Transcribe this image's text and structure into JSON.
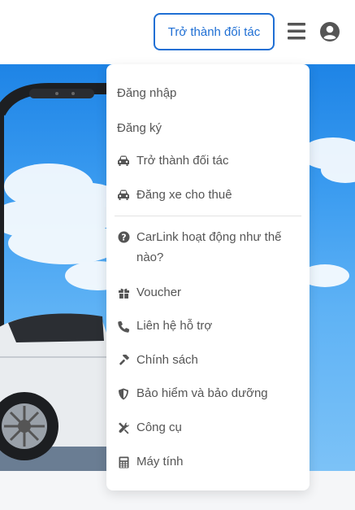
{
  "header": {
    "partner_button_label": "Trở thành đối tác",
    "menu_icon": "hamburger-icon",
    "user_icon": "user-circle-icon"
  },
  "menu": {
    "login": "Đăng nhập",
    "register": "Đăng ký",
    "become_partner": "Trở thành đối tác",
    "list_car": "Đăng xe cho thuê",
    "how_it_works_line1": "CarLink hoạt động như thế",
    "how_it_works_line2": "nào?",
    "voucher": "Voucher",
    "contact_support": "Liên hệ hỗ trợ",
    "policy": "Chính sách",
    "insurance": "Bảo hiểm và bảo dưỡng",
    "tools": "Công cụ",
    "calculator": "Máy tính"
  },
  "colors": {
    "accent": "#1f6fd4",
    "icon": "#555555",
    "sky": "#3a9bf0"
  }
}
